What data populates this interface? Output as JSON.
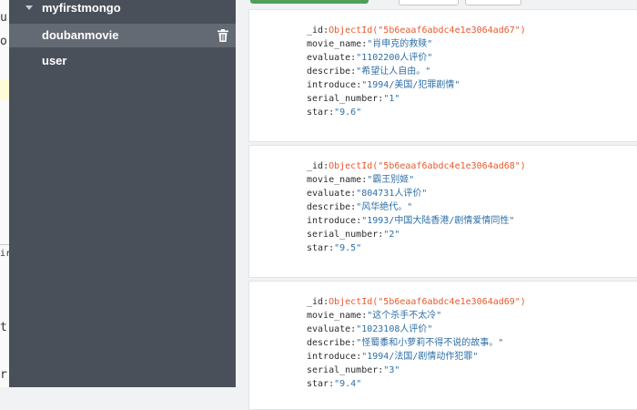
{
  "editor": {
    "glyphs": [
      "u",
      "o",
      "ir",
      "t",
      "r"
    ]
  },
  "sidebar": {
    "databases": [
      {
        "label": "myfirstmongo",
        "expanded": true
      },
      {
        "label": "doubanmovie",
        "selected": true,
        "icon": "trash-icon"
      },
      {
        "label": "user"
      }
    ]
  },
  "documents": [
    {
      "id_key": "_id",
      "id_func": "ObjectId(\"5b6eaaf6abdc4e1e3064ad67\")",
      "fields": [
        {
          "key": "movie_name",
          "value": "\"肖申克的救赎\""
        },
        {
          "key": "evaluate",
          "value": "\"1102200人评价\""
        },
        {
          "key": "describe",
          "value": "\"希望让人自由。\""
        },
        {
          "key": "introduce",
          "value": "\"1994/美国/犯罪剧情\""
        },
        {
          "key": "serial_number",
          "value": "\"1\""
        },
        {
          "key": "star",
          "value": "\"9.6\""
        }
      ]
    },
    {
      "id_key": "_id",
      "id_func": "ObjectId(\"5b6eaaf6abdc4e1e3064ad68\")",
      "fields": [
        {
          "key": "movie_name",
          "value": "\"霸王别姬\""
        },
        {
          "key": "evaluate",
          "value": "\"804731人评价\""
        },
        {
          "key": "describe",
          "value": "\"风华绝代。\""
        },
        {
          "key": "introduce",
          "value": "\"1993/中国大陆香港/剧情爱情同性\""
        },
        {
          "key": "serial_number",
          "value": "\"2\""
        },
        {
          "key": "star",
          "value": "\"9.5\""
        }
      ]
    },
    {
      "id_key": "_id",
      "id_func": "ObjectId(\"5b6eaaf6abdc4e1e3064ad69\")",
      "fields": [
        {
          "key": "movie_name",
          "value": "\"这个杀手不太冷\""
        },
        {
          "key": "evaluate",
          "value": "\"1023108人评价\""
        },
        {
          "key": "describe",
          "value": "\"怪蜀黍和小萝莉不得不说的故事。\""
        },
        {
          "key": "introduce",
          "value": "\"1994/法国/剧情动作犯罪\""
        },
        {
          "key": "serial_number",
          "value": "\"3\""
        },
        {
          "key": "star",
          "value": "\"9.4\""
        }
      ]
    }
  ],
  "colors": {
    "sidebar_bg": "#4a5059",
    "selected_row": "#646a73",
    "object_id": "#e8592e",
    "string_value": "#2e6fa8"
  }
}
